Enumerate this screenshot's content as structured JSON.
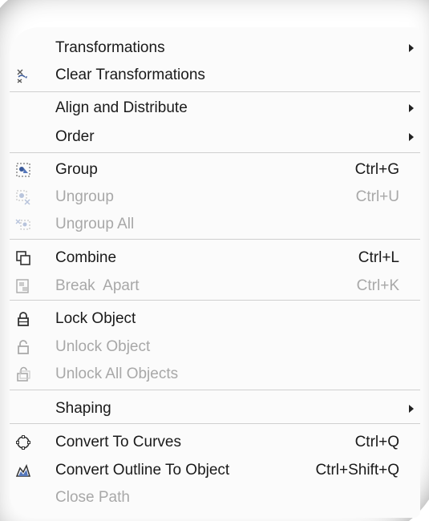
{
  "menu": {
    "items": [
      {
        "label": "Transformations",
        "shortcut": "",
        "submenu": true,
        "disabled": false,
        "icon": "none"
      },
      {
        "label": "Clear Transformations",
        "shortcut": "",
        "submenu": false,
        "disabled": false,
        "icon": "clear-transformations-icon"
      },
      {
        "label": "Align and Distribute",
        "shortcut": "",
        "submenu": true,
        "disabled": false,
        "icon": "none"
      },
      {
        "label": "Order",
        "shortcut": "",
        "submenu": true,
        "disabled": false,
        "icon": "none"
      },
      {
        "label": "Group",
        "shortcut": "Ctrl+G",
        "submenu": false,
        "disabled": false,
        "icon": "group-icon"
      },
      {
        "label": "Ungroup",
        "shortcut": "Ctrl+U",
        "submenu": false,
        "disabled": true,
        "icon": "ungroup-icon"
      },
      {
        "label": "Ungroup All",
        "shortcut": "",
        "submenu": false,
        "disabled": true,
        "icon": "ungroup-all-icon"
      },
      {
        "label": "Combine",
        "shortcut": "Ctrl+L",
        "submenu": false,
        "disabled": false,
        "icon": "combine-icon"
      },
      {
        "label": "Break  Apart",
        "shortcut": "Ctrl+K",
        "submenu": false,
        "disabled": true,
        "icon": "break-apart-icon"
      },
      {
        "label": "Lock Object",
        "shortcut": "",
        "submenu": false,
        "disabled": false,
        "icon": "lock-icon"
      },
      {
        "label": "Unlock Object",
        "shortcut": "",
        "submenu": false,
        "disabled": true,
        "icon": "unlock-icon"
      },
      {
        "label": "Unlock All Objects",
        "shortcut": "",
        "submenu": false,
        "disabled": true,
        "icon": "unlock-all-icon"
      },
      {
        "label": "Shaping",
        "shortcut": "",
        "submenu": true,
        "disabled": false,
        "icon": "none"
      },
      {
        "label": "Convert To Curves",
        "shortcut": "Ctrl+Q",
        "submenu": false,
        "disabled": false,
        "icon": "convert-curves-icon"
      },
      {
        "label": "Convert Outline To Object",
        "shortcut": "Ctrl+Shift+Q",
        "submenu": false,
        "disabled": false,
        "icon": "convert-outline-icon"
      },
      {
        "label": "Close Path",
        "shortcut": "",
        "submenu": false,
        "disabled": true,
        "icon": "none"
      }
    ]
  },
  "colors": {
    "text": "#1a1a1a",
    "disabled_text": "#a8a8a8",
    "separator": "#cfcfcf",
    "menu_background": "#fbfbfb",
    "icon_accent": "#3a5a9a"
  }
}
